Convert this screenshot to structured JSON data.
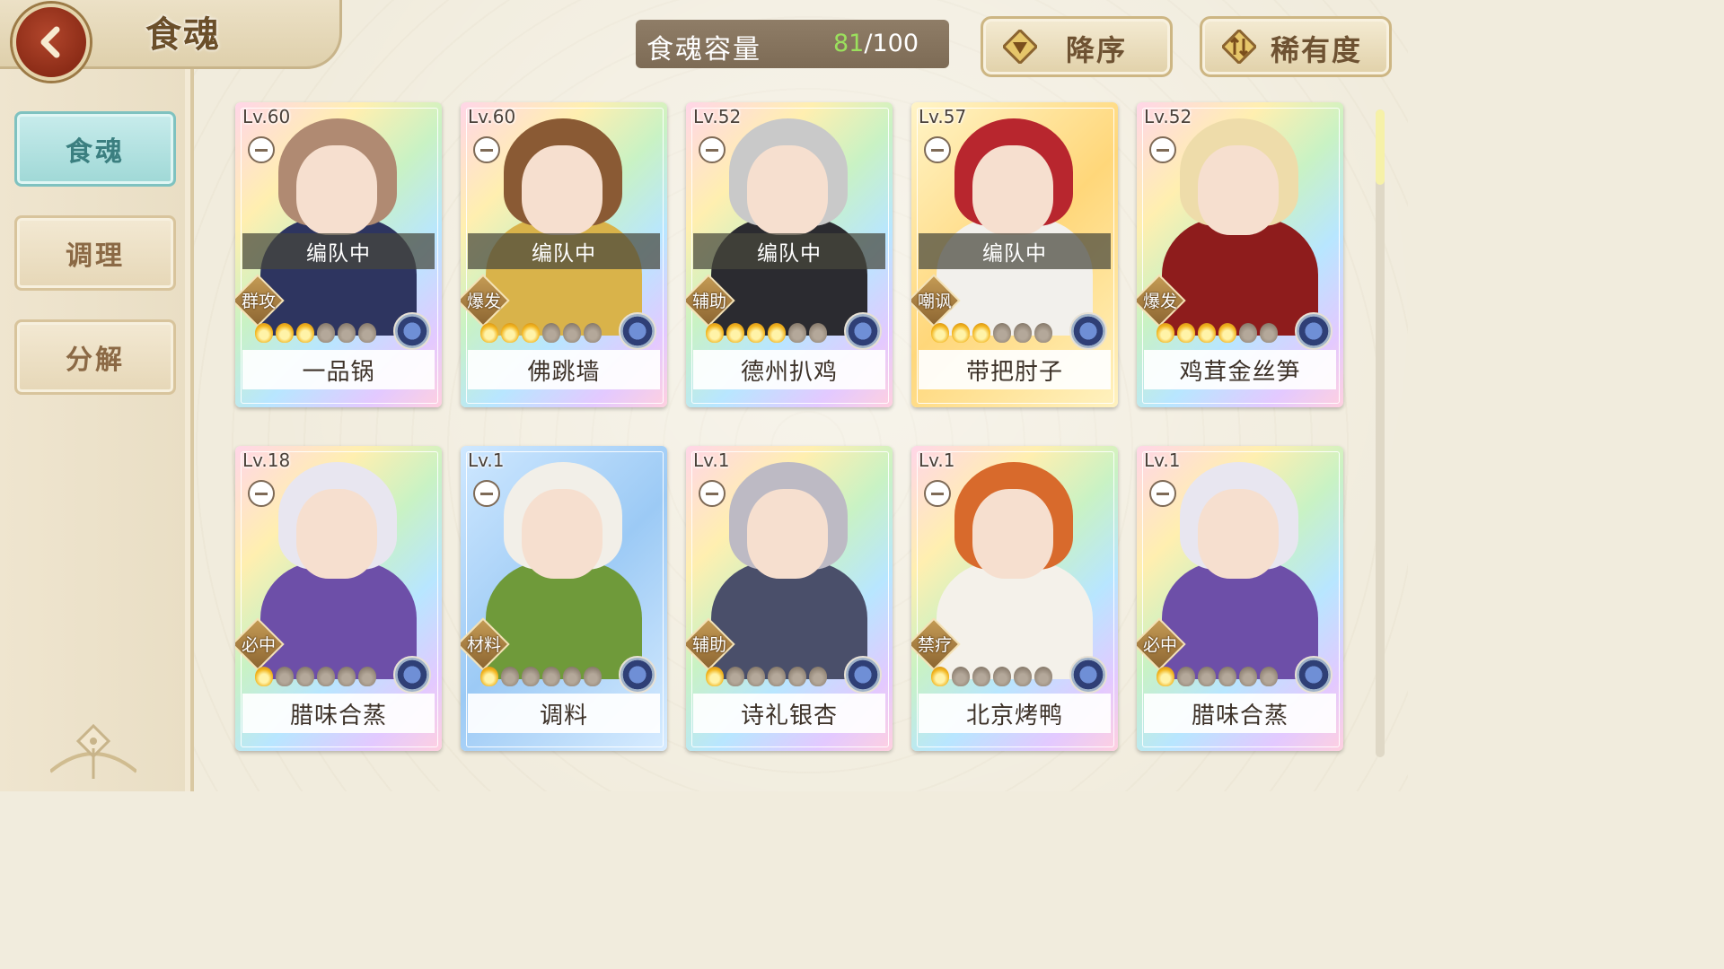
{
  "header": {
    "title": "食魂",
    "back_icon": "back-arrow-icon"
  },
  "sidebar": {
    "tabs": [
      {
        "label": "食魂",
        "active": true
      },
      {
        "label": "调理",
        "active": false
      },
      {
        "label": "分解",
        "active": false
      }
    ]
  },
  "capacity": {
    "label": "食魂容量",
    "current": "81",
    "max": "/100",
    "current_color": "#9be05d"
  },
  "sort": {
    "order_label": "降序",
    "order_icon": "triangle-down-icon",
    "by_label": "稀有度",
    "by_icon": "sort-arrows-icon"
  },
  "cards": [
    {
      "level": "Lv.60",
      "status": "编队中",
      "role": "群攻",
      "stars": 3,
      "name": "一品锅",
      "frame": "rainbow",
      "hair": "#b08a72",
      "body": "#2e3560"
    },
    {
      "level": "Lv.60",
      "status": "编队中",
      "role": "爆发",
      "stars": 3,
      "name": "佛跳墙",
      "frame": "rainbow",
      "hair": "#8a5a34",
      "body": "#d9b34a"
    },
    {
      "level": "Lv.52",
      "status": "编队中",
      "role": "辅助",
      "stars": 4,
      "name": "德州扒鸡",
      "frame": "rainbow",
      "hair": "#c9c9c9",
      "body": "#2b2b30"
    },
    {
      "level": "Lv.57",
      "status": "编队中",
      "role": "嘲讽",
      "stars": 3,
      "name": "带把肘子",
      "frame": "gold",
      "hair": "#b8262e",
      "body": "#f2f0ec"
    },
    {
      "level": "Lv.52",
      "status": "",
      "role": "爆发",
      "stars": 4,
      "name": "鸡茸金丝笋",
      "frame": "rainbow",
      "hair": "#eedcaa",
      "body": "#8e1c1c"
    },
    {
      "level": "Lv.18",
      "status": "",
      "role": "必中",
      "stars": 1,
      "name": "腊味合蒸",
      "frame": "rainbow",
      "hair": "#e8e6f0",
      "body": "#6d4fa8"
    },
    {
      "level": "Lv.1",
      "status": "",
      "role": "材料",
      "stars": 1,
      "name": "调料",
      "frame": "blue",
      "hair": "#f2efe8",
      "body": "#6f9a3a"
    },
    {
      "level": "Lv.1",
      "status": "",
      "role": "辅助",
      "stars": 1,
      "name": "诗礼银杏",
      "frame": "rainbow",
      "hair": "#bdbac4",
      "body": "#4a4f6a"
    },
    {
      "level": "Lv.1",
      "status": "",
      "role": "禁疗",
      "stars": 1,
      "name": "北京烤鸭",
      "frame": "rainbow",
      "hair": "#d86a2c",
      "body": "#f4f1ea"
    },
    {
      "level": "Lv.1",
      "status": "",
      "role": "必中",
      "stars": 1,
      "name": "腊味合蒸",
      "frame": "rainbow",
      "hair": "#e8e6f0",
      "body": "#6d4fa8"
    }
  ],
  "element_icon": "flower-element-icon",
  "rarity_icon": "flame-icon",
  "colors": {
    "accent_teal": "#9fd8d6",
    "brown_text": "#6b4f2a",
    "capacity_bg": "#7d6b55"
  }
}
